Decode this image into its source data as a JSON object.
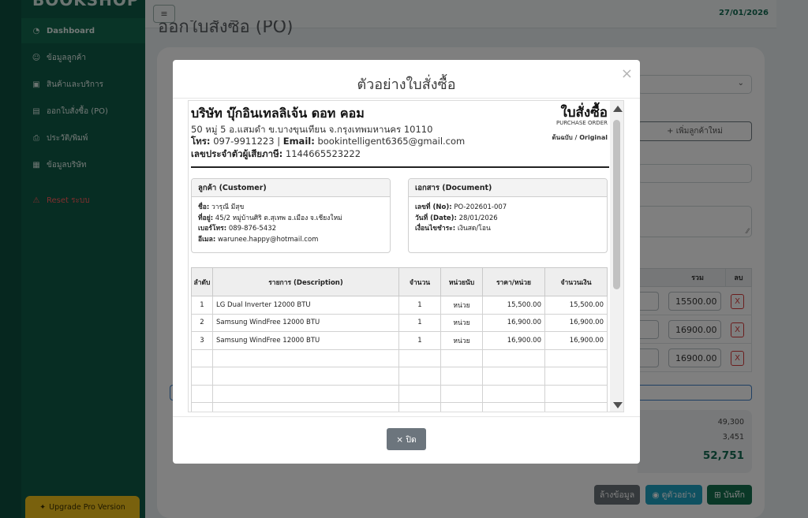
{
  "app": {
    "logo_text": "BOOKSHOP",
    "date": "27/01/2026",
    "page_title": "ออกใบสั่งซื้อ (PO)"
  },
  "sidebar": {
    "items": [
      {
        "icon": "dashboard-icon",
        "label": "Dashboard"
      },
      {
        "icon": "users-icon",
        "label": "ข้อมูลลูกค้า"
      },
      {
        "icon": "box-icon",
        "label": "สินค้าและบริการ"
      },
      {
        "icon": "file-icon",
        "label": "ออกใบสั่งซื้อ (PO)"
      },
      {
        "icon": "printer-icon",
        "label": "ประวัติ/พิมพ์"
      },
      {
        "icon": "building-icon",
        "label": "ข้อมูลบริษัท"
      }
    ],
    "reset_label": "Reset ระบบ",
    "upgrade_label": "Upgrade Pro Version"
  },
  "form": {
    "add_customer_label": "+ เพิ่มลูกค้าใหม่",
    "table_headers": {
      "total": "รวม",
      "delete": "ลบ"
    },
    "row_amounts": [
      "15500.00",
      "16900.00",
      "16900.00"
    ],
    "delete_label": "X",
    "summary": {
      "subtotal": "49,300",
      "vat": "3,451",
      "grand_total": "52,751"
    },
    "buttons": {
      "clear": "ล้างข้อมูล",
      "preview": "ดูตัวอย่าง",
      "save": "บันทึก"
    }
  },
  "modal": {
    "title": "ตัวอย่างใบสั่งซื้อ",
    "close_button": "× ปิด",
    "company": {
      "name": "บริษัท บุ๊กอินเทลลิเจ้น ดอท คอม",
      "address": "50 หมู่ 5 อ.แสมดำ ข.บางขุนเทียน จ.กรุงเทพมหานคร 10110",
      "phone_label": "โทร:",
      "phone": "097-9911223",
      "email_label": "Email:",
      "email": "bookintelligent6365@gmail.com",
      "tax_label": "เลขประจำตัวผู้เสียภาษี:",
      "tax_id": "1144665523222"
    },
    "doc_title": "ใบสั่งซื้อ",
    "doc_subtitle": "PURCHASE ORDER",
    "doc_copy": "ต้นฉบับ / Original",
    "customer": {
      "heading": "ลูกค้า (Customer)",
      "name_label": "ชื่อ:",
      "name": "วารุณี มีสุข",
      "address_label": "ที่อยู่:",
      "address": "45/2 หมู่บ้านศิริ ต.สุเทพ อ.เมือง จ.เชียงใหม่",
      "phone_label": "เบอร์โทร:",
      "phone": "089-876-5432",
      "email_label": "อีเมล:",
      "email": "warunee.happy@hotmail.com"
    },
    "document": {
      "heading": "เอกสาร (Document)",
      "no_label": "เลขที่ (No):",
      "no": "PO-202601-007",
      "date_label": "วันที่ (Date):",
      "date": "28/01/2026",
      "terms_label": "เงื่อนไขชำระ:",
      "terms": "เงินสด/โอน"
    },
    "items_table": {
      "headers": [
        "ลำดับ",
        "รายการ (Description)",
        "จำนวน",
        "หน่วยนับ",
        "ราคา/หน่วย",
        "จำนวนเงิน"
      ],
      "rows": [
        [
          "1",
          "LG Dual Inverter 12000 BTU",
          "1",
          "หน่วย",
          "15,500.00",
          "15,500.00"
        ],
        [
          "2",
          "Samsung WindFree 12000 BTU",
          "1",
          "หน่วย",
          "16,900.00",
          "16,900.00"
        ],
        [
          "3",
          "Samsung WindFree 12000 BTU",
          "1",
          "หน่วย",
          "16,900.00",
          "16,900.00"
        ]
      ]
    }
  }
}
